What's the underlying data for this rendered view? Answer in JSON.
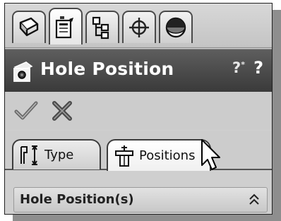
{
  "manager_tabs": [
    {
      "icon": "feature-manager-icon",
      "active": false
    },
    {
      "icon": "property-manager-icon",
      "active": true
    },
    {
      "icon": "configuration-manager-icon",
      "active": false
    },
    {
      "icon": "dimxpert-manager-icon",
      "active": false
    },
    {
      "icon": "display-manager-icon",
      "active": false
    }
  ],
  "property_manager": {
    "title": "Hole Position",
    "title_icon": "hole-position-icon",
    "help_details_label": "?",
    "help_details_mark": "*",
    "help_label": "?"
  },
  "actions": {
    "ok_icon": "checkmark-icon",
    "cancel_icon": "close-icon"
  },
  "tabs": {
    "type_label": "Type",
    "positions_label": "Positions",
    "active": "Positions"
  },
  "section": {
    "title": "Hole Position(s)",
    "collapse_icon": "double-chevron-up-icon"
  },
  "colors": {
    "title_bar": "#4a4a4a",
    "panel": "#cfcfcf",
    "text_light": "#ffffff"
  }
}
